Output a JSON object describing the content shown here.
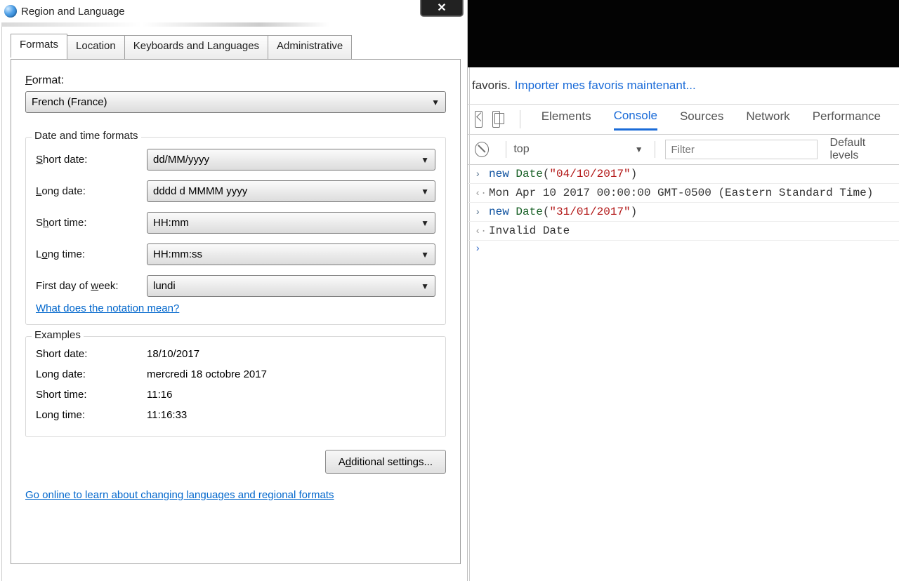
{
  "dialog": {
    "title": "Region and Language",
    "tabs": [
      "Formats",
      "Location",
      "Keyboards and Languages",
      "Administrative"
    ],
    "active_tab": 0,
    "format_label": "Format:",
    "format_label_key": "F",
    "format_value": "French (France)",
    "formats_group": {
      "title": "Date and time formats",
      "rows": [
        {
          "label": "Short date:",
          "key": "S",
          "value": "dd/MM/yyyy"
        },
        {
          "label": "Long date:",
          "key": "L",
          "value": "dddd d MMMM yyyy"
        },
        {
          "label": "Short time:",
          "key": "h",
          "value": "HH:mm"
        },
        {
          "label": "Long time:",
          "key": "O",
          "value": "HH:mm:ss"
        },
        {
          "label": "First day of week:",
          "key": "w",
          "value": "lundi"
        }
      ],
      "row_labels": {
        "short_date": "Short date:",
        "long_date": "Long date:",
        "short_time": "Short time:",
        "long_time": "Long time:",
        "first_day": "First day of week:"
      },
      "notation_link": "What does the notation mean?"
    },
    "examples": {
      "title": "Examples",
      "rows": [
        {
          "label": "Short date:",
          "value": "18/10/2017"
        },
        {
          "label": "Long date:",
          "value": "mercredi 18 octobre 2017"
        },
        {
          "label": "Short time:",
          "value": "11:16"
        },
        {
          "label": "Long time:",
          "value": "11:16:33"
        }
      ]
    },
    "additional_btn": "Additional settings...",
    "additional_key": "d",
    "bottom_link": "Go online to learn about changing languages and regional formats"
  },
  "browser": {
    "bookmark_text": "favoris.",
    "import_link": "Importer mes favoris maintenant...",
    "devtools_tabs": [
      "Elements",
      "Console",
      "Sources",
      "Network",
      "Performance"
    ],
    "devtools_active": 1,
    "context": "top",
    "filter_placeholder": "Filter",
    "levels": "Default levels",
    "console_lines": [
      {
        "type": "input",
        "raw": "new Date(\"04/10/2017\")",
        "tokens": [
          {
            "t": "kw",
            "v": "new "
          },
          {
            "t": "cls",
            "v": "Date"
          },
          {
            "t": "plain",
            "v": "("
          },
          {
            "t": "str",
            "v": "\"04/10/2017\""
          },
          {
            "t": "plain",
            "v": ")"
          }
        ]
      },
      {
        "type": "output",
        "text": "Mon Apr 10 2017 00:00:00 GMT-0500 (Eastern Standard Time)"
      },
      {
        "type": "input",
        "raw": "new Date(\"31/01/2017\")",
        "tokens": [
          {
            "t": "kw",
            "v": "new "
          },
          {
            "t": "cls",
            "v": "Date"
          },
          {
            "t": "plain",
            "v": "("
          },
          {
            "t": "str",
            "v": "\"31/01/2017\""
          },
          {
            "t": "plain",
            "v": ")"
          }
        ]
      },
      {
        "type": "output",
        "text": "Invalid Date"
      },
      {
        "type": "prompt",
        "text": ""
      }
    ]
  }
}
